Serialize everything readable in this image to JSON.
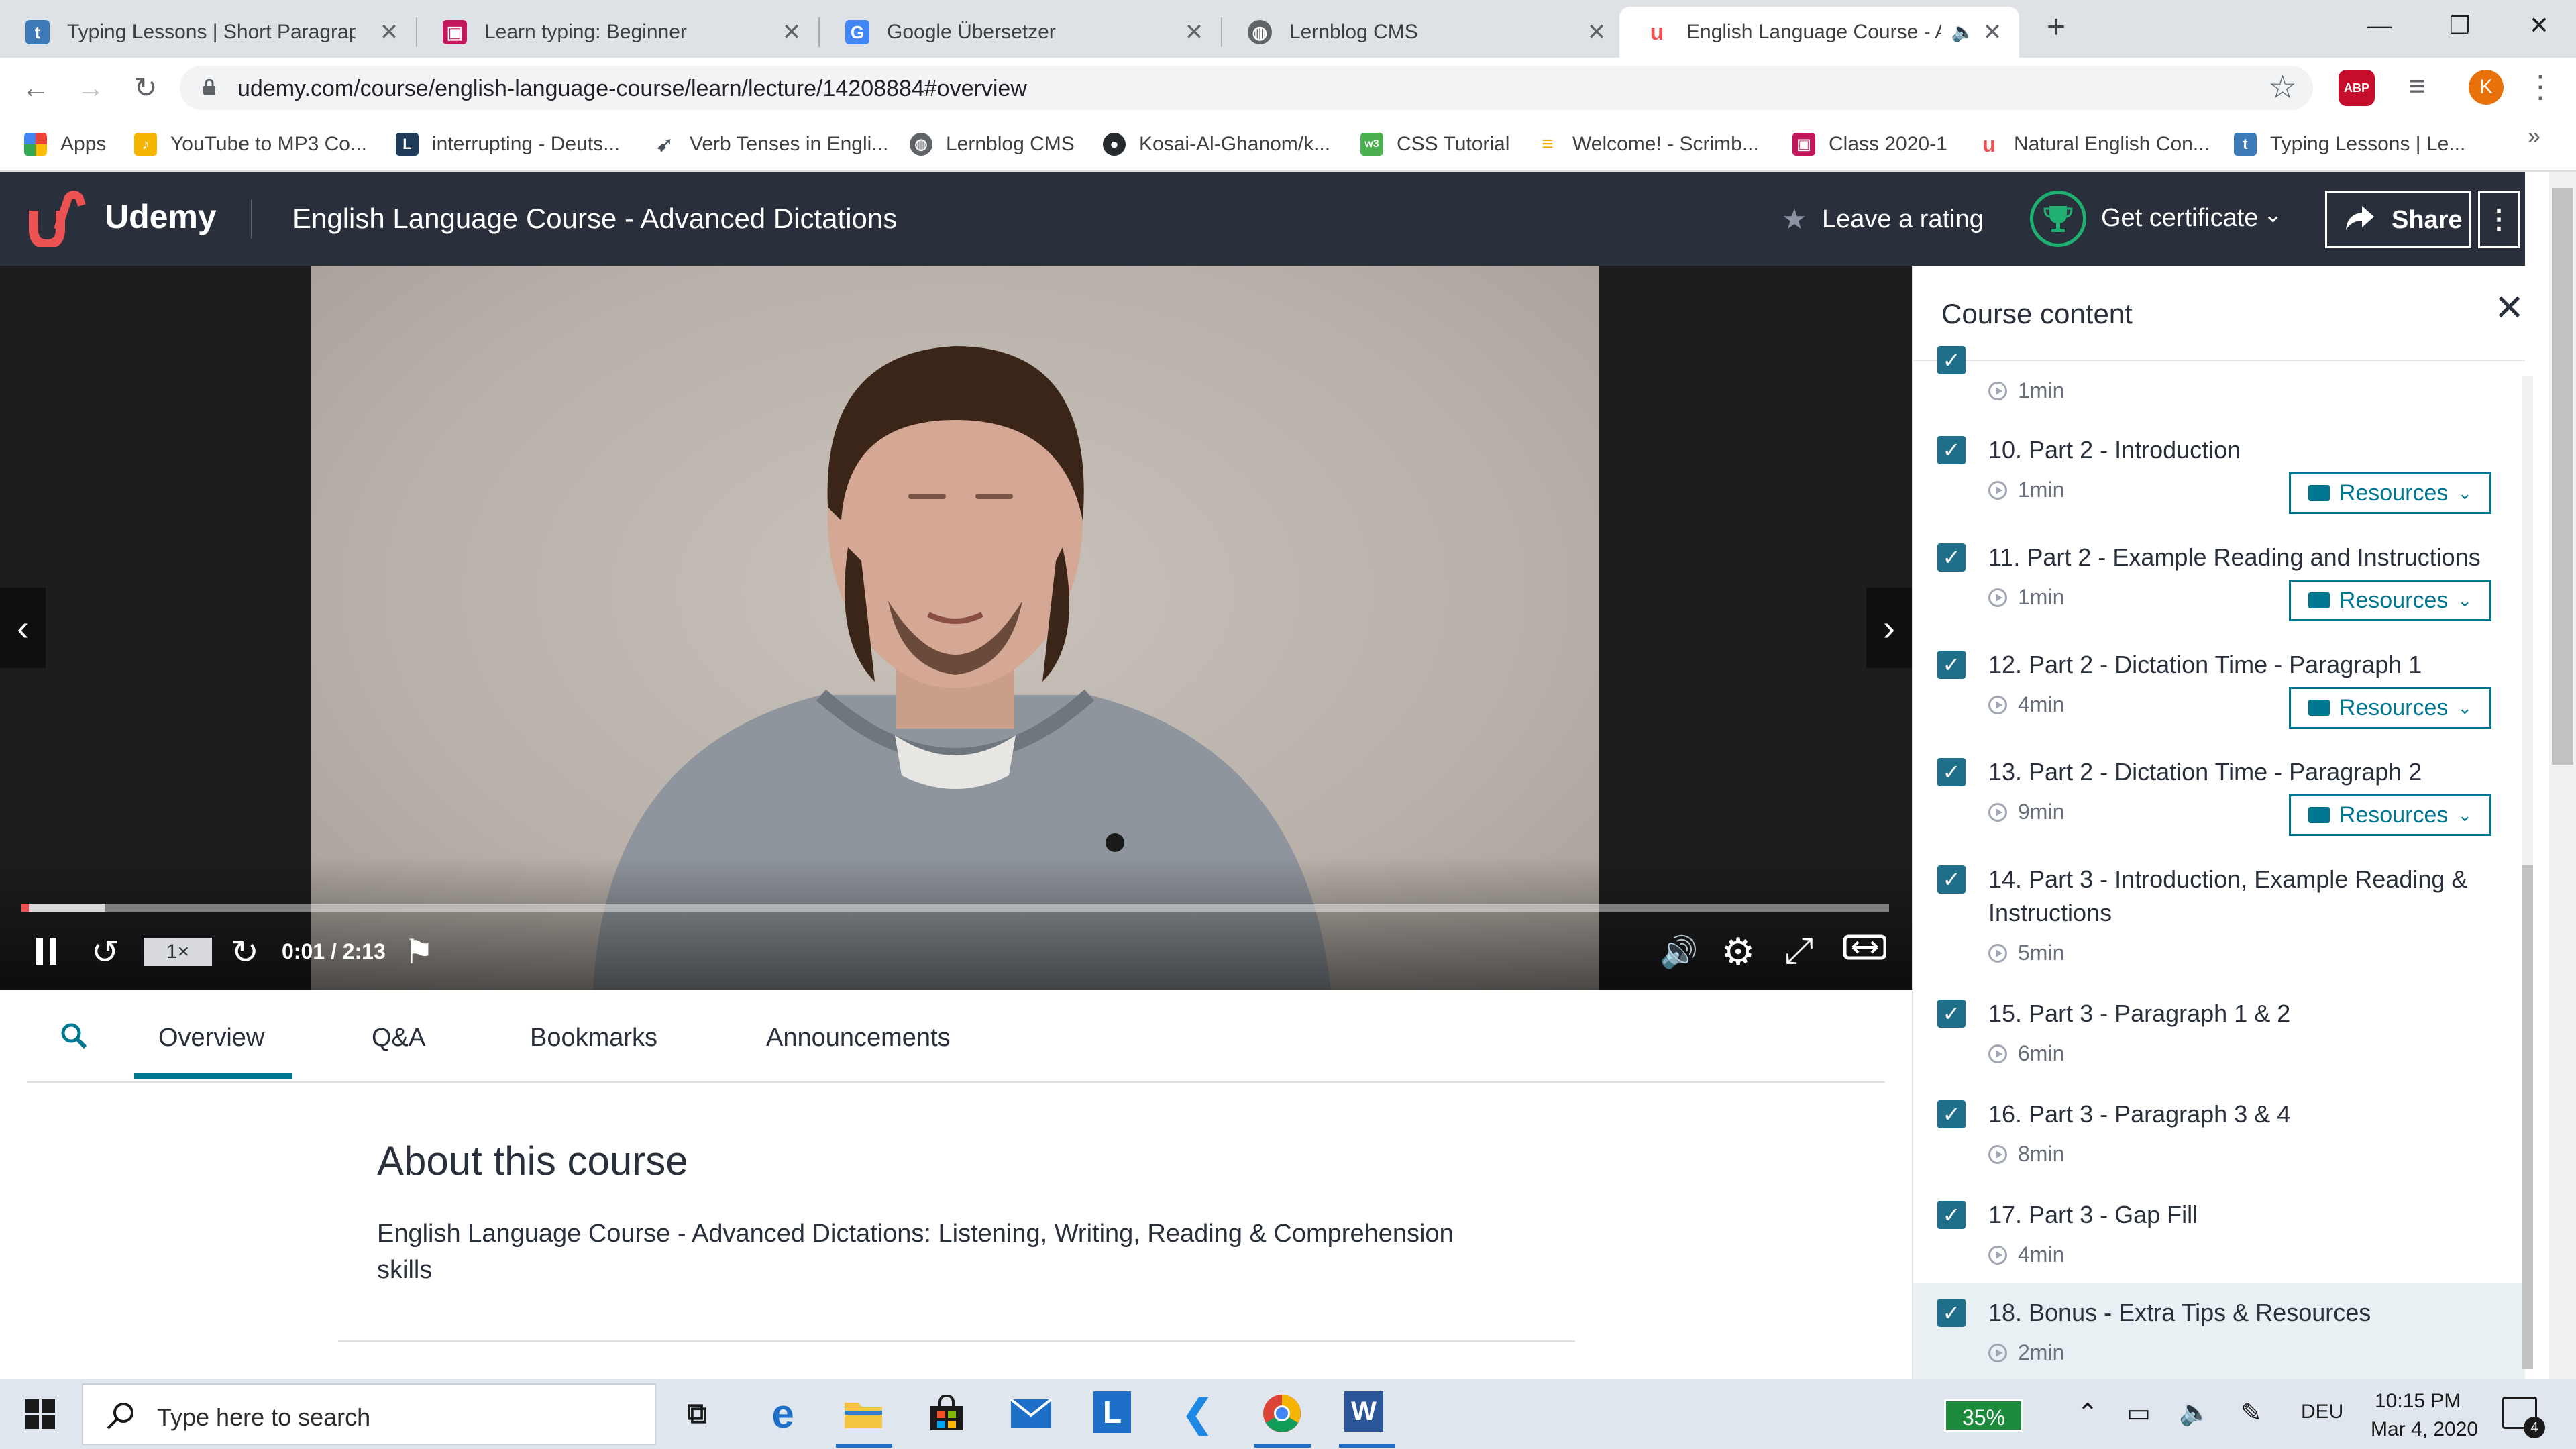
{
  "browser": {
    "tabs": [
      {
        "title": "Typing Lessons | Short Paragraph",
        "favicon": "typing-t-icon",
        "color": "#3d7ab8"
      },
      {
        "title": "Learn typing: Beginner",
        "favicon": "typing-beginner-icon",
        "color": "#c2185b"
      },
      {
        "title": "Google Übersetzer",
        "favicon": "google-translate-icon",
        "color": "#4285f4"
      },
      {
        "title": "Lernblog CMS",
        "favicon": "globe-icon",
        "color": "#5f6368"
      },
      {
        "title": "English Language Course - A",
        "favicon": "udemy-icon",
        "color": "#ec5252",
        "active": true
      }
    ],
    "url": "udemy.com/course/english-language-course/learn/lecture/14208884#overview",
    "profile_initial": "K",
    "abp_label": "ABP"
  },
  "bookmarks": [
    {
      "label": "Apps",
      "icon": "apps-grid-icon",
      "color": "#ea4335"
    },
    {
      "label": "YouTube to MP3 Co...",
      "icon": "yt-mp3-icon",
      "color": "#f5b400"
    },
    {
      "label": "interrupting - Deuts...",
      "icon": "dict-icon",
      "color": "#1f3b5a"
    },
    {
      "label": "Verb Tenses in Engli...",
      "icon": "bird-icon",
      "color": "#4a5160"
    },
    {
      "label": "Lernblog CMS",
      "icon": "globe-icon",
      "color": "#5f6368"
    },
    {
      "label": "Kosai-Al-Ghanom/k...",
      "icon": "github-icon",
      "color": "#24292e"
    },
    {
      "label": "CSS Tutorial",
      "icon": "w3-icon",
      "color": "#4caf50"
    },
    {
      "label": "Welcome! - Scrimb...",
      "icon": "scrimba-icon",
      "color": "#f2a900"
    },
    {
      "label": "Class 2020-1",
      "icon": "class-icon",
      "color": "#c2185b"
    },
    {
      "label": "Natural English Con...",
      "icon": "udemy-icon",
      "color": "#ec5252"
    },
    {
      "label": "Typing Lessons | Le...",
      "icon": "typing-t-icon",
      "color": "#3d7ab8"
    }
  ],
  "udemy": {
    "logo_text": "Udemy",
    "course_title": "English Language Course - Advanced Dictations",
    "leave_rating": "Leave a rating",
    "get_certificate": "Get certificate",
    "share": "Share",
    "brand_color": "#ec5252",
    "header_color": "#29303b"
  },
  "player": {
    "speed": "1×",
    "time": "0:01 / 2:13",
    "progress_fraction": 0.004,
    "buffered_fraction": 0.045
  },
  "tabs": {
    "overview": "Overview",
    "qa": "Q&A",
    "bookmarks": "Bookmarks",
    "announcements": "Announcements"
  },
  "about": {
    "title": "About this course",
    "description": "English Language Course - Advanced Dictations: Listening, Writing, Reading & Comprehension skills"
  },
  "sidebar": {
    "title": "Course content",
    "partial_duration": "1min",
    "resources_label": "Resources",
    "lectures": [
      {
        "title": "10. Part 2 - Introduction",
        "duration": "1min",
        "resources": true
      },
      {
        "title": "11. Part 2 - Example Reading and Instructions",
        "duration": "1min",
        "resources": true
      },
      {
        "title": "12. Part 2 - Dictation Time - Paragraph 1",
        "duration": "4min",
        "resources": true
      },
      {
        "title": "13. Part 2 - Dictation Time - Paragraph 2",
        "duration": "9min",
        "resources": true
      },
      {
        "title": "14. Part 3 - Introduction, Example Reading & Instructions",
        "duration": "5min",
        "resources": false
      },
      {
        "title": "15. Part 3 - Paragraph 1 & 2",
        "duration": "6min",
        "resources": false
      },
      {
        "title": "16. Part 3 - Paragraph 3 & 4",
        "duration": "8min",
        "resources": false
      },
      {
        "title": "17. Part 3 - Gap Fill",
        "duration": "4min",
        "resources": false
      },
      {
        "title": "18. Bonus - Extra Tips & Resources",
        "duration": "2min",
        "resources": false,
        "current": true
      }
    ]
  },
  "taskbar": {
    "search_placeholder": "Type here to search",
    "battery": "35%",
    "language": "DEU",
    "time": "10:15 PM",
    "date": "Mar 4, 2020",
    "notifications": "4",
    "apps": [
      "task-view-icon",
      "edge-icon",
      "file-explorer-icon",
      "store-icon",
      "mail-icon",
      "l-app-icon",
      "vscode-icon",
      "chrome-icon",
      "word-icon"
    ]
  }
}
